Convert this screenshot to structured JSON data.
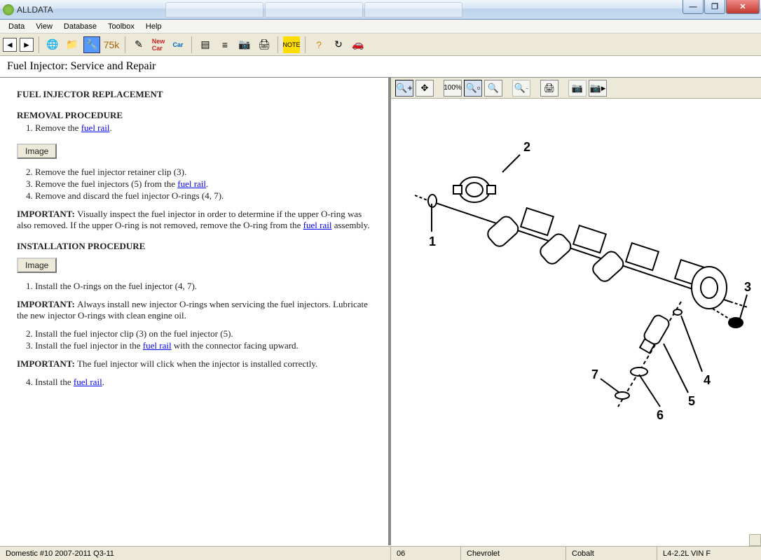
{
  "app": {
    "title": "ALLDATA"
  },
  "menu": {
    "items": [
      "Data",
      "View",
      "Database",
      "Toolbox",
      "Help"
    ]
  },
  "page": {
    "title": "Fuel Injector:  Service and Repair",
    "heading": "FUEL INJECTOR REPLACEMENT",
    "removal_heading": "REMOVAL PROCEDURE",
    "removal_step1_pre": "Remove the ",
    "removal_step1_link": "fuel rail",
    "removal_step1_post": ".",
    "image_btn": "Image",
    "removal_step2": "Remove the fuel injector retainer clip (3).",
    "removal_step3_pre": "Remove the fuel injectors (5) from the ",
    "removal_step3_link": "fuel rail",
    "removal_step3_post": ".",
    "removal_step4": "Remove and discard the fuel injector O-rings (4, 7).",
    "important_label": "IMPORTANT:  ",
    "important1_text_pre": "Visually inspect the fuel injector in order to determine if the upper O-ring was also removed. If the upper O-ring is not removed, remove the O-ring from the ",
    "important1_link": "fuel rail",
    "important1_text_post": " assembly.",
    "install_heading": "INSTALLATION PROCEDURE",
    "install_step1": "Install the O-rings on the fuel injector (4, 7).",
    "important2_text": "Always install new injector O-rings when servicing the fuel injectors. Lubricate the new injector O-rings with clean engine oil.",
    "install_step2": "Install the fuel injector clip (3) on the fuel injector (5).",
    "install_step3_pre": "Install the fuel injector in the ",
    "install_step3_link": "fuel rail",
    "install_step3_post": " with the connector facing upward.",
    "important3_text": "The fuel injector will click when the injector is installed correctly.",
    "install_step4_pre": "Install the ",
    "install_step4_link": "fuel rail",
    "install_step4_post": "."
  },
  "diagram": {
    "labels": [
      "1",
      "2",
      "3",
      "4",
      "5",
      "6",
      "7"
    ]
  },
  "status": {
    "database": "Domestic #10 2007-2011 Q3-11",
    "year": "06",
    "make": "Chevrolet",
    "model": "Cobalt",
    "engine": "L4-2.2L VIN F"
  }
}
